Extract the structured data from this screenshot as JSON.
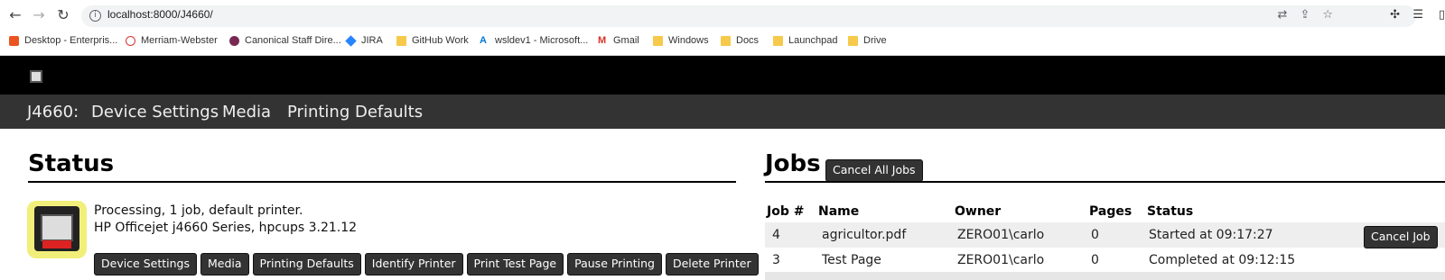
{
  "browser": {
    "url": "localhost:8000/J4660/",
    "back_icon": "back-arrow-icon",
    "forward_icon": "forward-arrow-icon",
    "reload_icon": "reload-icon"
  },
  "bookmarks": [
    {
      "label": "Desktop - Enterpris...",
      "icon": "ubuntu-icon"
    },
    {
      "label": "Merriam-Webster",
      "icon": "mw-icon"
    },
    {
      "label": "Canonical Staff Dire...",
      "icon": "canonical-icon"
    },
    {
      "label": "JIRA",
      "icon": "jira-icon"
    },
    {
      "label": "GitHub Work",
      "icon": "folder-icon"
    },
    {
      "label": "wsldev1 - Microsoft...",
      "icon": "azure-icon"
    },
    {
      "label": "Gmail",
      "icon": "gmail-icon"
    },
    {
      "label": "Windows",
      "icon": "folder-icon"
    },
    {
      "label": "Docs",
      "icon": "folder-icon"
    },
    {
      "label": "Launchpad",
      "icon": "folder-icon"
    },
    {
      "label": "Drive",
      "icon": "folder-icon"
    }
  ],
  "nav": {
    "printer": "J4660:",
    "device_settings": "Device Settings",
    "media": "Media",
    "printing_defaults": "Printing Defaults"
  },
  "status": {
    "heading": "Status",
    "line1": "Processing, 1 job, default printer.",
    "line2": "HP Officejet j4660 Series, hpcups 3.21.12",
    "buttons": [
      "Device Settings",
      "Media",
      "Printing Defaults",
      "Identify Printer",
      "Print Test Page",
      "Pause Printing",
      "Delete Printer"
    ]
  },
  "jobs": {
    "heading": "Jobs",
    "cancel_all": "Cancel All Jobs",
    "columns": [
      "Job #",
      "Name",
      "Owner",
      "Pages",
      "Status"
    ],
    "rows": [
      {
        "job": "4",
        "name": "agricultor.pdf",
        "owner": "ZERO01\\carlo",
        "pages": "0",
        "status": "Started at 09:17:27",
        "action": "Cancel Job"
      },
      {
        "job": "3",
        "name": "Test Page",
        "owner": "ZERO01\\carlo",
        "pages": "0",
        "status": "Completed at 09:12:15",
        "action": ""
      }
    ]
  },
  "colors": {
    "header_bg": "#000000",
    "nav_bg": "#333333",
    "button_bg": "#333333",
    "printer_icon_bg": "#f1ef7a"
  }
}
